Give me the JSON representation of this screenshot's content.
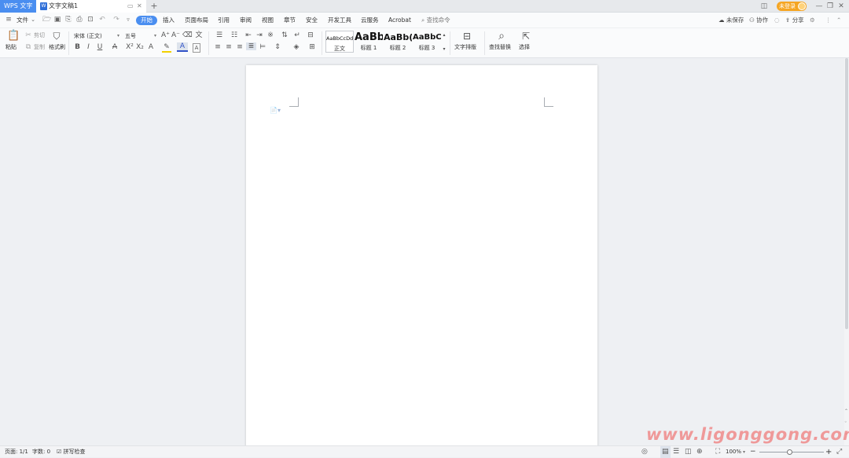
{
  "titlebar": {
    "app_tab": "WPS 文字",
    "doc_tab": "文字文稿1",
    "doc_icon": "W",
    "login_label": "未登录",
    "new_tab_symbol": "+",
    "min_symbol": "—",
    "restore_symbol": "❐",
    "close_symbol": "✕"
  },
  "menu": {
    "file_label": "文件",
    "items": [
      "开始",
      "插入",
      "页面布局",
      "引用",
      "审阅",
      "视图",
      "章节",
      "安全",
      "开发工具",
      "云服务",
      "Acrobat"
    ],
    "search_placeholder": "查找命令",
    "right": {
      "unsaved": "未保存",
      "collab": "协作",
      "share": "分享"
    }
  },
  "ribbon": {
    "paste": "粘贴",
    "cut": "剪切",
    "copy": "复制",
    "format_painter": "格式刷",
    "font_name": "宋体 (正文)",
    "font_size": "五号",
    "styles": [
      {
        "preview": "AaBbCcDd",
        "label": "正文"
      },
      {
        "preview": "AaBb",
        "label": "标题 1"
      },
      {
        "preview": "AaBb(",
        "label": "标题 2"
      },
      {
        "preview": "AaBbC(",
        "label": "标题 3"
      }
    ],
    "text_layout": "文字排版",
    "find_replace": "查找替换",
    "select": "选择"
  },
  "statusbar": {
    "page": "页面: 1/1",
    "word_count": "字数: 0",
    "spell_check": "拼写检查",
    "zoom": "100%",
    "zoom_minus": "−",
    "zoom_plus": "+"
  },
  "watermark": "www.ligonggong.com",
  "colors": {
    "accent": "#4a8ef0",
    "login": "#f5a523",
    "watermark": "#f08a8a"
  }
}
